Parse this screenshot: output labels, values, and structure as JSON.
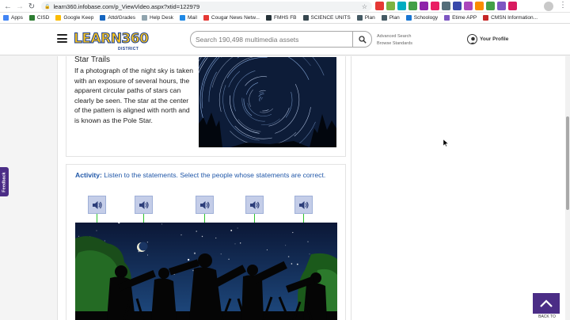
{
  "browser": {
    "url": "learn360.infobase.com/p_ViewVideo.aspx?xtid=122979",
    "bookmarks": [
      {
        "label": "Apps",
        "color": "#4285f4"
      },
      {
        "label": "CISD",
        "color": "#2e7d32"
      },
      {
        "label": "Google Keep",
        "color": "#fbbc04"
      },
      {
        "label": "Attd/Grades",
        "color": "#1565c0"
      },
      {
        "label": "Help Desk",
        "color": "#90a4ae"
      },
      {
        "label": "Mail",
        "color": "#1e88e5"
      },
      {
        "label": "Cougar News Netw...",
        "color": "#e53935"
      },
      {
        "label": "FMHS FB",
        "color": "#263238"
      },
      {
        "label": "SCIENCE UNITS",
        "color": "#37474f"
      },
      {
        "label": "Plan",
        "color": "#455a64"
      },
      {
        "label": "Plan",
        "color": "#455a64"
      },
      {
        "label": "Schoology",
        "color": "#1976d2"
      },
      {
        "label": "Etime APP",
        "color": "#7e57c2"
      },
      {
        "label": "CMSN Information...",
        "color": "#c62828"
      }
    ],
    "extension_colors": [
      "#e53935",
      "#7cb342",
      "#00acc1",
      "#43a047",
      "#8e24aa",
      "#e91e63",
      "#546e7a",
      "#3949ab",
      "#ab47bc",
      "#fb8c00",
      "#43a047",
      "#7e57c2",
      "#d81b60"
    ]
  },
  "header": {
    "logo_text": "LEARN360",
    "logo_sub": "DISTRICT",
    "search_placeholder": "Search 190,498 multimedia assets",
    "advanced_search": "Advanced Search",
    "browse_standards": "Browse Standards",
    "profile_label": "Your Profile"
  },
  "star_trails": {
    "title": "Star Trails",
    "text": "If a photograph of the night sky is taken with an exposure of several hours, the apparent circular paths of stars can clearly be seen. The star at the center of the pattern is aligned with north and is known as the Pole Star."
  },
  "activity": {
    "label": "Activity:",
    "instructions": "Listen to the statements. Select the people whose statements are correct.",
    "audio_buttons": 5
  },
  "feedback_label": "Feedback",
  "back_to_top": "BACK TO",
  "colors": {
    "accent_purple": "#4b2d86",
    "activity_blue": "#2057a8",
    "connector_green": "#2cc32c",
    "audio_button": "#c4cde8"
  }
}
